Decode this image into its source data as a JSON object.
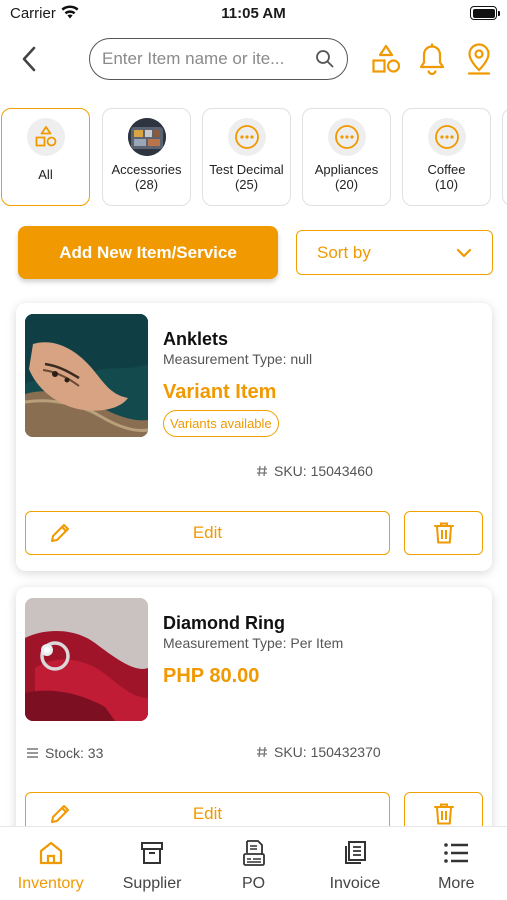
{
  "status_bar": {
    "carrier": "Carrier",
    "time": "11:05 AM"
  },
  "search": {
    "placeholder": "Enter Item name or ite..."
  },
  "categories": [
    {
      "label": "All",
      "count": "",
      "icon": "shapes-icon",
      "active": true
    },
    {
      "label": "Accessories",
      "count": "(28)",
      "icon": "accessories-photo",
      "active": false
    },
    {
      "label": "Test Decimal",
      "count": "(25)",
      "icon": "more-dots-icon",
      "active": false
    },
    {
      "label": "Appliances",
      "count": "(20)",
      "icon": "more-dots-icon",
      "active": false
    },
    {
      "label": "Coffee",
      "count": "(10)",
      "icon": "more-dots-icon",
      "active": false
    }
  ],
  "actions": {
    "add_label": "Add New Item/Service",
    "sort_label": "Sort by"
  },
  "items": [
    {
      "name": "Anklets",
      "measurement": "Measurement Type: null",
      "price": "Variant Item",
      "badge": "Variants available",
      "sku": "SKU: 15043460",
      "edit_label": "Edit"
    },
    {
      "name": "Diamond Ring",
      "measurement": "Measurement Type: Per Item",
      "price": "PHP 80.00",
      "stock": "Stock: 33",
      "sku": "SKU: 150432370",
      "edit_label": "Edit"
    }
  ],
  "nav": [
    {
      "label": "Inventory",
      "icon": "home-icon",
      "active": true
    },
    {
      "label": "Supplier",
      "icon": "archive-box-icon",
      "active": false
    },
    {
      "label": "PO",
      "icon": "purchase-order-icon",
      "active": false
    },
    {
      "label": "Invoice",
      "icon": "invoice-icon",
      "active": false
    },
    {
      "label": "More",
      "icon": "menu-list-icon",
      "active": false
    }
  ],
  "colors": {
    "accent": "#f09900",
    "text": "#1a1a1a",
    "muted": "#555555",
    "border": "#e0e0e0"
  }
}
